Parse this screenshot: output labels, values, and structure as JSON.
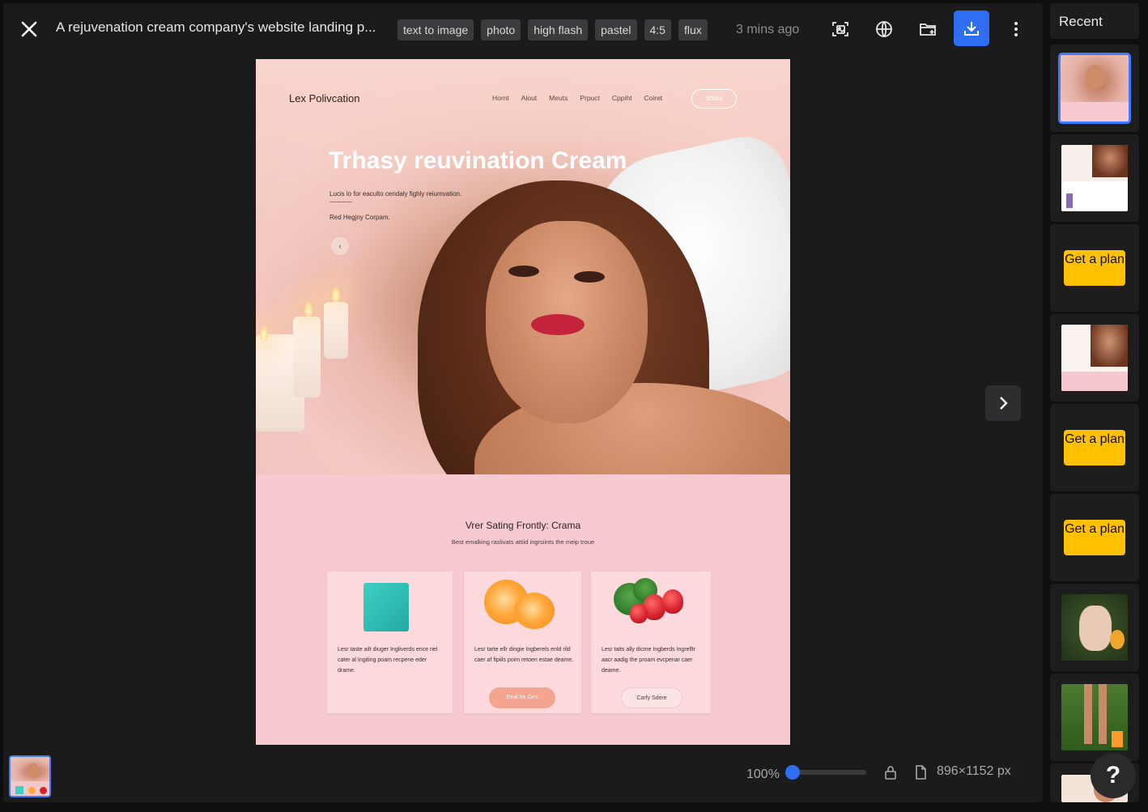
{
  "header": {
    "title": "A rejuvenation cream company's website landing p...",
    "tags": [
      "text to image",
      "photo",
      "high flash",
      "pastel",
      "4:5",
      "flux"
    ],
    "time": "3 mins ago"
  },
  "toolbar": {
    "icons": [
      "image-crop-icon",
      "globe-icon",
      "folder-add-icon",
      "download-icon",
      "more-vertical-icon"
    ]
  },
  "generated_page": {
    "brand": "Lex Polivcation",
    "nav": [
      "Hornt",
      "Alout",
      "Meuts",
      "Prpuct",
      "Cppiht",
      "Coiret"
    ],
    "nav_cta": "Shure",
    "hero_title": "Trhasy reuvination Cream",
    "hero_sub": "Lucis lo for eaculto cendaly fighly reiumvation.",
    "hero_sub2": "Red Hegjny Corpam.",
    "hero_arrow": "‹",
    "section_title": "Vrer Sating Frontly: Crama",
    "section_sub": "Best emalking raslivats attiid ingrsiints the meip troue",
    "cards": [
      {
        "text": "Lesr taste ailt diuger Ingliverds ence riel cater al Ingiting poam recpene eder drame.",
        "button": ""
      },
      {
        "text": "Lesr tarte ellr dingie Ingberels enld rild caer af fipiils poim retoen estae deame.",
        "button": "Eeal Ire Ges"
      },
      {
        "text": "Lesr taits ally dicme Ingberds Ingrelltr aacr aadig the proam evcpenar caer deame.",
        "button": "Carfy Sdere"
      }
    ]
  },
  "footer": {
    "zoom": "100%",
    "zoom_level_percent": 0,
    "dimensions": "896×1152 px"
  },
  "sidebar": {
    "label": "Recent",
    "get_plan": "Get a plan"
  },
  "help": "?",
  "colors": {
    "accent": "#2f6ef2",
    "selected_border": "#3d7bff",
    "plan_yellow": "#ffc000",
    "bg": "#1b1b1c"
  }
}
